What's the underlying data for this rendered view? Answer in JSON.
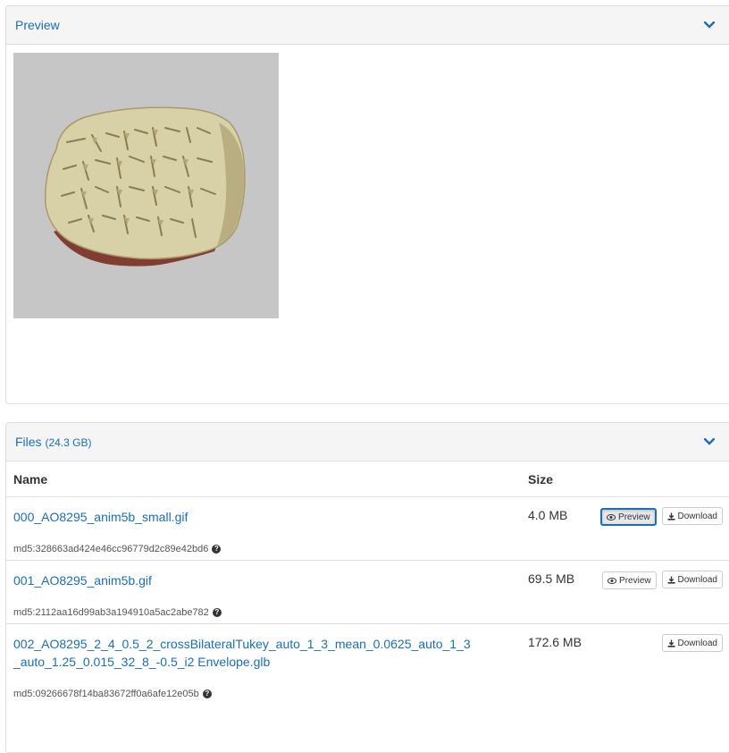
{
  "preview_panel": {
    "title": "Preview",
    "icon": "chevron-down-icon",
    "image_alt": "clay tablet with cuneiform"
  },
  "files_panel": {
    "title": "Files",
    "total_size": "(24.3 GB)",
    "icon": "chevron-down-icon",
    "columns": {
      "name": "Name",
      "size": "Size"
    },
    "rows": [
      {
        "name": "000_AO8295_anim5b_small.gif",
        "size": "4.0 MB",
        "md5": "md5:328663ad424e46cc96779d2c89e42bd6",
        "preview_label": "Preview",
        "download_label": "Download"
      },
      {
        "name": "001_AO8295_anim5b.gif",
        "size": "69.5 MB",
        "md5": "md5:2112aa16d99ab3a194910a5ac2abe782",
        "preview_label": "Preview",
        "download_label": "Download"
      },
      {
        "name_line1": "002_AO8295_2_4_0.5_2_crossBilateralTukey_auto_1_3_mean_0.0625_auto_1_3",
        "name_line2": "_auto_1.25_0.015_32_8_-0.5_i2 Envelope.glb",
        "size": "172.6 MB",
        "md5": "md5:09266678f14ba83672ff0a6afe12e05b",
        "download_label": "Download"
      }
    ]
  },
  "colors": {
    "link": "#1a6fb5",
    "heading_bg": "#f5f5f5",
    "border": "#dddddd",
    "preview_bg": "#c6c6c6"
  }
}
